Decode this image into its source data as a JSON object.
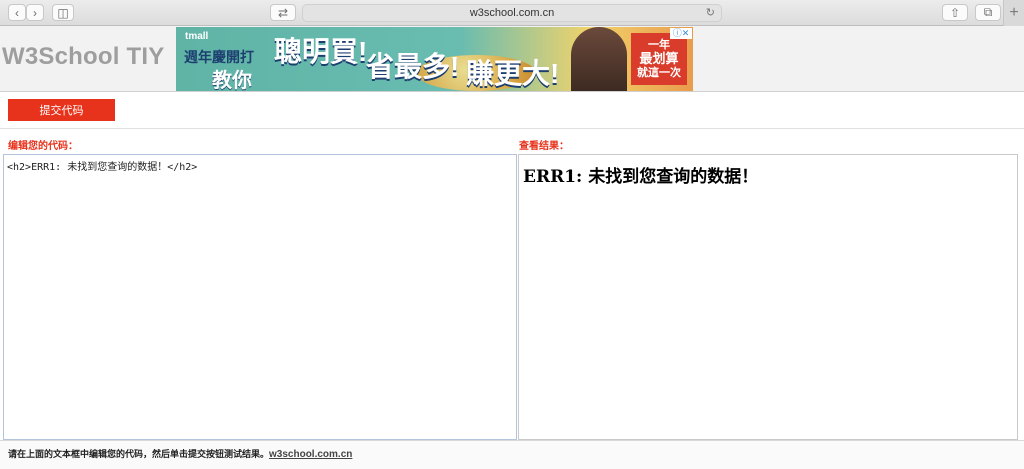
{
  "browser": {
    "url": "w3school.com.cn",
    "icons": [
      "back-icon",
      "forward-icon",
      "sidebar-icon",
      "tab-switch-icon",
      "reload-icon",
      "share-icon",
      "tabs-overview-icon",
      "new-tab-icon"
    ]
  },
  "header": {
    "logo": "W3School TIY"
  },
  "ad": {
    "brand": "tmall",
    "line1": "週年慶開打",
    "line2": "教你",
    "big1": "聰明買!",
    "big2": "省最多!",
    "big3": "賺更大!",
    "box_line1": "一年",
    "box_line2": "最划算",
    "box_line3": "就這一次",
    "close": "ⓘ✕"
  },
  "toolbar": {
    "submit_label": "提交代码"
  },
  "editor": {
    "label": "编辑您的代码：",
    "code": "<h2>ERR1: 未找到您查询的数据！</h2>"
  },
  "result": {
    "label": "查看结果：",
    "heading": "ERR1: 未找到您查询的数据！"
  },
  "footer": {
    "text": "请在上面的文本框中编辑您的代码，然后单击提交按钮测试结果。",
    "link": "w3school.com.cn"
  }
}
